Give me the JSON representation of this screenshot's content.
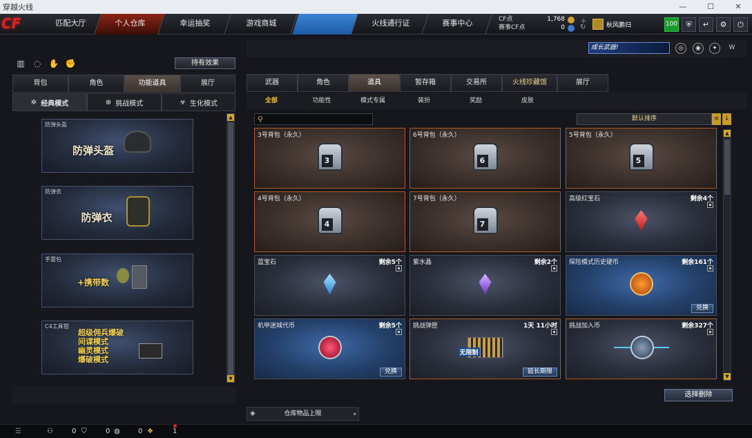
{
  "window": {
    "title": "穿越火线",
    "controls": [
      "—",
      "☐",
      "✕"
    ]
  },
  "logo": "CF",
  "nav": [
    {
      "label": "匹配大厅"
    },
    {
      "label": "个人仓库"
    },
    {
      "label": "幸运抽奖"
    },
    {
      "label": "游戏商城"
    },
    {
      "label": ""
    },
    {
      "label": "火线通行证"
    },
    {
      "label": "赛事中心"
    }
  ],
  "currency": {
    "cf_label": "CF点",
    "cf_value": "1,768",
    "match_label": "赛事CF点",
    "match_value": "0"
  },
  "user": {
    "name": "秋风鹏归"
  },
  "topbuttons": {
    "level": "100"
  },
  "banner": {
    "growth": "成长武器!"
  },
  "left": {
    "effect_button": "持有效果",
    "tabs": [
      "背包",
      "角色",
      "功能道具",
      "展厅"
    ],
    "modes": [
      "经典模式",
      "挑战模式",
      "生化模式"
    ],
    "cards": [
      {
        "label": "防弹头盔",
        "title": "防弹头盔"
      },
      {
        "label": "防弹衣",
        "title": "防弹衣"
      },
      {
        "label": "手雷包",
        "title": "+携带数"
      },
      {
        "label": "C4工具钳",
        "lines": [
          "超级佣兵爆破",
          "间谍模式",
          "幽灵模式",
          "爆破模式"
        ]
      }
    ]
  },
  "right": {
    "tabs": [
      "武器",
      "角色",
      "道具",
      "暂存箱",
      "交易所",
      "火线珍藏馆",
      "展厅"
    ],
    "subtabs": [
      "全部",
      "功能性",
      "模式专属",
      "装扮",
      "奖励",
      "皮肤"
    ],
    "search_placeholder": "",
    "sort": "默认排序",
    "items": [
      {
        "name": "3号背包（永久）",
        "bag": "3"
      },
      {
        "name": "6号背包（永久）",
        "bag": "6"
      },
      {
        "name": "5号背包（永久）",
        "bag": "5"
      },
      {
        "name": "4号背包（永久）",
        "bag": "4"
      },
      {
        "name": "7号背包（永久）",
        "bag": "7"
      },
      {
        "name": "高级红宝石",
        "remain": "剩余4个"
      },
      {
        "name": "蓝宝石",
        "remain": "剩余5个"
      },
      {
        "name": "紫水晶",
        "remain": "剩余2个"
      },
      {
        "name": "探险模式历史硬币",
        "remain": "剩余161个",
        "action": "兑换"
      },
      {
        "name": "机甲迷城代币",
        "remain": "剩余5个",
        "action": "兑换"
      },
      {
        "name": "挑战弹匣",
        "remain": "1天 11小时",
        "action": "延长期限",
        "badge": "无限制"
      },
      {
        "name": "挑战加入币",
        "remain": "剩余327个"
      }
    ],
    "batch_button": "选择删除",
    "capacity": "仓库物品上限"
  },
  "status": {
    "v1": "0",
    "v2": "0",
    "v3": "0",
    "v4": "1"
  },
  "colors": {
    "accent_gold": "#f0c030",
    "bag_border": "#b05a24",
    "active_nav": "#8c2416"
  }
}
